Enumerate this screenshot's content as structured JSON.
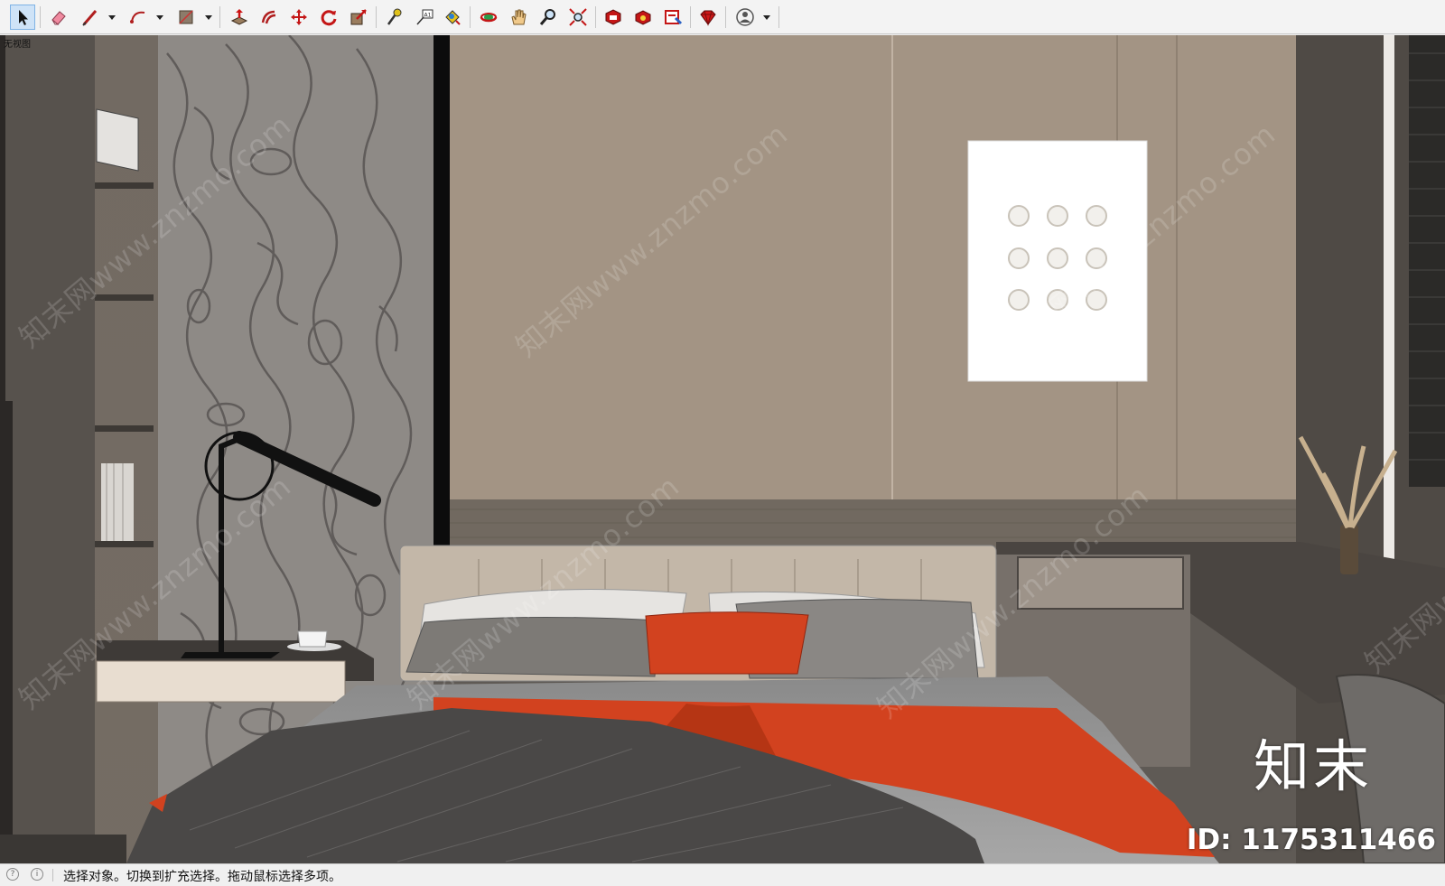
{
  "toolbar": {
    "tools": [
      {
        "name": "select-tool-icon",
        "active": true
      },
      {
        "name": "eraser-tool-icon"
      },
      {
        "name": "line-tool-icon",
        "dropdown": true
      },
      {
        "name": "arc-tool-icon",
        "dropdown": true
      },
      {
        "name": "rectangle-tool-icon",
        "dropdown": true
      },
      {
        "name": "push-pull-tool-icon"
      },
      {
        "name": "offset-tool-icon"
      },
      {
        "name": "move-tool-icon"
      },
      {
        "name": "rotate-tool-icon"
      },
      {
        "name": "scale-tool-icon"
      },
      {
        "name": "tape-measure-tool-icon"
      },
      {
        "name": "text-tool-icon"
      },
      {
        "name": "paint-bucket-tool-icon"
      },
      {
        "name": "orbit-tool-icon"
      },
      {
        "name": "pan-tool-icon"
      },
      {
        "name": "zoom-tool-icon"
      },
      {
        "name": "zoom-extents-tool-icon"
      },
      {
        "name": "3d-warehouse-icon"
      },
      {
        "name": "extension-warehouse-icon"
      },
      {
        "name": "layout-icon"
      },
      {
        "name": "ruby-console-icon"
      },
      {
        "name": "account-icon",
        "dropdown": true
      }
    ]
  },
  "viewport": {
    "scene_label": "无视图",
    "watermark_text": "知末网www.znzmo.com",
    "brand_text": "知末",
    "asset_id": "ID: 1175311466"
  },
  "statusbar": {
    "text": "选择对象。切换到扩充选择。拖动鼠标选择多项。"
  },
  "colors": {
    "wall_panel": "#a39484",
    "marble": "#8f8c88",
    "blanket_orange": "#d2421f",
    "toolbar_bg": "#f3f3f3"
  }
}
